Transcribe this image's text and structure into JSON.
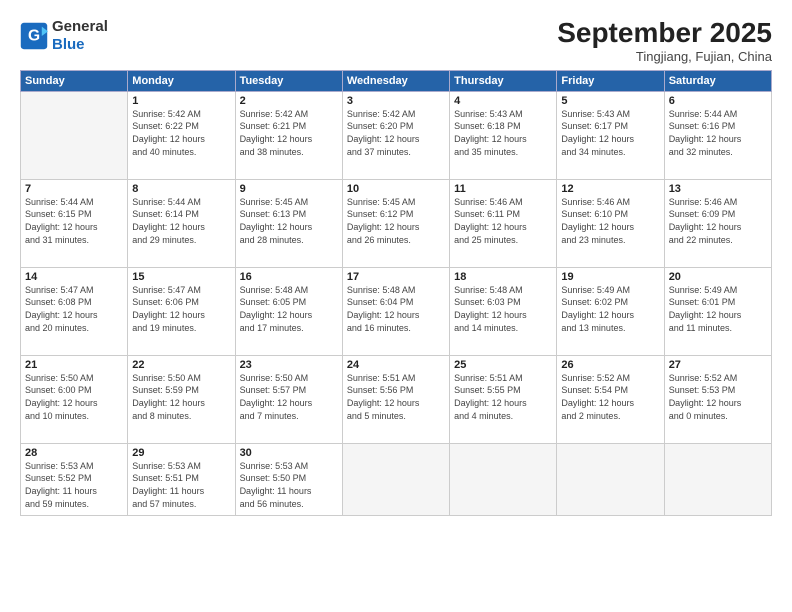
{
  "logo": {
    "line1": "General",
    "line2": "Blue"
  },
  "title": "September 2025",
  "subtitle": "Tingjiang, Fujian, China",
  "weekdays": [
    "Sunday",
    "Monday",
    "Tuesday",
    "Wednesday",
    "Thursday",
    "Friday",
    "Saturday"
  ],
  "weeks": [
    [
      {
        "num": "",
        "info": ""
      },
      {
        "num": "1",
        "info": "Sunrise: 5:42 AM\nSunset: 6:22 PM\nDaylight: 12 hours\nand 40 minutes."
      },
      {
        "num": "2",
        "info": "Sunrise: 5:42 AM\nSunset: 6:21 PM\nDaylight: 12 hours\nand 38 minutes."
      },
      {
        "num": "3",
        "info": "Sunrise: 5:42 AM\nSunset: 6:20 PM\nDaylight: 12 hours\nand 37 minutes."
      },
      {
        "num": "4",
        "info": "Sunrise: 5:43 AM\nSunset: 6:18 PM\nDaylight: 12 hours\nand 35 minutes."
      },
      {
        "num": "5",
        "info": "Sunrise: 5:43 AM\nSunset: 6:17 PM\nDaylight: 12 hours\nand 34 minutes."
      },
      {
        "num": "6",
        "info": "Sunrise: 5:44 AM\nSunset: 6:16 PM\nDaylight: 12 hours\nand 32 minutes."
      }
    ],
    [
      {
        "num": "7",
        "info": "Sunrise: 5:44 AM\nSunset: 6:15 PM\nDaylight: 12 hours\nand 31 minutes."
      },
      {
        "num": "8",
        "info": "Sunrise: 5:44 AM\nSunset: 6:14 PM\nDaylight: 12 hours\nand 29 minutes."
      },
      {
        "num": "9",
        "info": "Sunrise: 5:45 AM\nSunset: 6:13 PM\nDaylight: 12 hours\nand 28 minutes."
      },
      {
        "num": "10",
        "info": "Sunrise: 5:45 AM\nSunset: 6:12 PM\nDaylight: 12 hours\nand 26 minutes."
      },
      {
        "num": "11",
        "info": "Sunrise: 5:46 AM\nSunset: 6:11 PM\nDaylight: 12 hours\nand 25 minutes."
      },
      {
        "num": "12",
        "info": "Sunrise: 5:46 AM\nSunset: 6:10 PM\nDaylight: 12 hours\nand 23 minutes."
      },
      {
        "num": "13",
        "info": "Sunrise: 5:46 AM\nSunset: 6:09 PM\nDaylight: 12 hours\nand 22 minutes."
      }
    ],
    [
      {
        "num": "14",
        "info": "Sunrise: 5:47 AM\nSunset: 6:08 PM\nDaylight: 12 hours\nand 20 minutes."
      },
      {
        "num": "15",
        "info": "Sunrise: 5:47 AM\nSunset: 6:06 PM\nDaylight: 12 hours\nand 19 minutes."
      },
      {
        "num": "16",
        "info": "Sunrise: 5:48 AM\nSunset: 6:05 PM\nDaylight: 12 hours\nand 17 minutes."
      },
      {
        "num": "17",
        "info": "Sunrise: 5:48 AM\nSunset: 6:04 PM\nDaylight: 12 hours\nand 16 minutes."
      },
      {
        "num": "18",
        "info": "Sunrise: 5:48 AM\nSunset: 6:03 PM\nDaylight: 12 hours\nand 14 minutes."
      },
      {
        "num": "19",
        "info": "Sunrise: 5:49 AM\nSunset: 6:02 PM\nDaylight: 12 hours\nand 13 minutes."
      },
      {
        "num": "20",
        "info": "Sunrise: 5:49 AM\nSunset: 6:01 PM\nDaylight: 12 hours\nand 11 minutes."
      }
    ],
    [
      {
        "num": "21",
        "info": "Sunrise: 5:50 AM\nSunset: 6:00 PM\nDaylight: 12 hours\nand 10 minutes."
      },
      {
        "num": "22",
        "info": "Sunrise: 5:50 AM\nSunset: 5:59 PM\nDaylight: 12 hours\nand 8 minutes."
      },
      {
        "num": "23",
        "info": "Sunrise: 5:50 AM\nSunset: 5:57 PM\nDaylight: 12 hours\nand 7 minutes."
      },
      {
        "num": "24",
        "info": "Sunrise: 5:51 AM\nSunset: 5:56 PM\nDaylight: 12 hours\nand 5 minutes."
      },
      {
        "num": "25",
        "info": "Sunrise: 5:51 AM\nSunset: 5:55 PM\nDaylight: 12 hours\nand 4 minutes."
      },
      {
        "num": "26",
        "info": "Sunrise: 5:52 AM\nSunset: 5:54 PM\nDaylight: 12 hours\nand 2 minutes."
      },
      {
        "num": "27",
        "info": "Sunrise: 5:52 AM\nSunset: 5:53 PM\nDaylight: 12 hours\nand 0 minutes."
      }
    ],
    [
      {
        "num": "28",
        "info": "Sunrise: 5:53 AM\nSunset: 5:52 PM\nDaylight: 11 hours\nand 59 minutes."
      },
      {
        "num": "29",
        "info": "Sunrise: 5:53 AM\nSunset: 5:51 PM\nDaylight: 11 hours\nand 57 minutes."
      },
      {
        "num": "30",
        "info": "Sunrise: 5:53 AM\nSunset: 5:50 PM\nDaylight: 11 hours\nand 56 minutes."
      },
      {
        "num": "",
        "info": ""
      },
      {
        "num": "",
        "info": ""
      },
      {
        "num": "",
        "info": ""
      },
      {
        "num": "",
        "info": ""
      }
    ]
  ]
}
